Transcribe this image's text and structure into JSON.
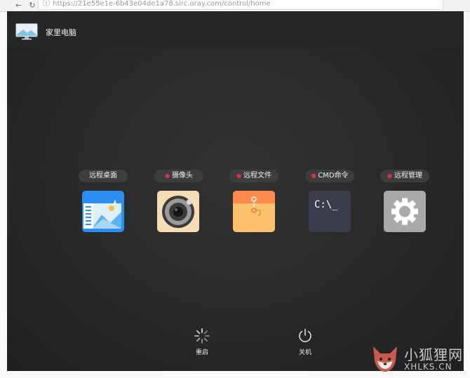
{
  "browser": {
    "url": "https://21e55e1e-6b43e04de1a78.sirc.oray.com/control/home"
  },
  "header": {
    "title": "家里电脑"
  },
  "tiles": [
    {
      "label": "远程桌面",
      "dot": false,
      "icon": "remote-desktop-icon"
    },
    {
      "label": "摄像头",
      "dot": true,
      "icon": "camera-icon"
    },
    {
      "label": "远程文件",
      "dot": true,
      "icon": "folder-icon"
    },
    {
      "label": "CMD命令",
      "dot": true,
      "icon": "terminal-icon",
      "icon_text": "C:\\_"
    },
    {
      "label": "远程管理",
      "dot": true,
      "icon": "gear-icon"
    }
  ],
  "actions": {
    "restart": "重启",
    "shutdown": "关机"
  },
  "watermark": {
    "cn": "小狐狸网",
    "en": "XHLKS.CN"
  },
  "colors": {
    "accent_dot": "#e0303a",
    "background": "#2a2a2a"
  }
}
